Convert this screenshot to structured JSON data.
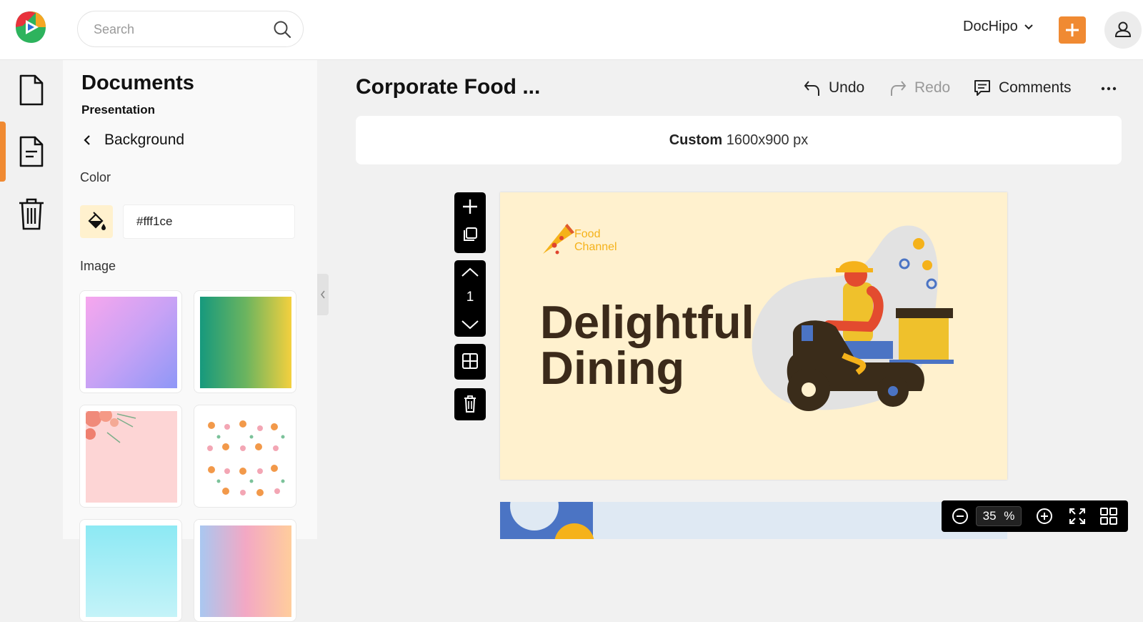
{
  "header": {
    "search_placeholder": "Search",
    "workspace": "DocHipo",
    "accent": "#f08a32"
  },
  "rail": {
    "items": [
      {
        "icon": "document-icon",
        "active": false
      },
      {
        "icon": "document-text-icon",
        "active": true
      },
      {
        "icon": "trash-icon",
        "active": false
      }
    ]
  },
  "panel": {
    "title": "Documents",
    "subtitle": "Presentation",
    "back_label": "Background",
    "color_label": "Color",
    "color_value": "#fff1ce",
    "color_value_text": "#fff1ce",
    "image_label": "Image"
  },
  "editor": {
    "doc_title": "Corporate Food ...",
    "undo": "Undo",
    "redo": "Redo",
    "comments": "Comments",
    "size_label": "Custom",
    "size_value": "1600x900 px",
    "page_number": "1"
  },
  "slide": {
    "brand_line1": "Food",
    "brand_line2": "Channel",
    "headline_line1": "Delightful",
    "headline_line2": "Dining",
    "background": "#fff1ce"
  },
  "zoom": {
    "value": "35",
    "unit": "%"
  }
}
